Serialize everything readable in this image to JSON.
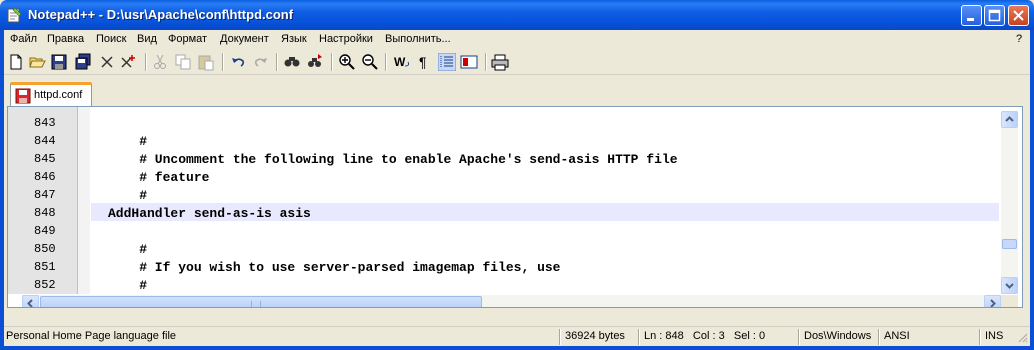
{
  "window": {
    "title": "Notepad++ - D:\\usr\\Apache\\conf\\httpd.conf",
    "icon": "notepad-plus-icon"
  },
  "menu": {
    "items": [
      "Файл",
      "Правка",
      "Поиск",
      "Вид",
      "Формат",
      "Документ",
      "Язык",
      "Настройки",
      "Выполнить..."
    ],
    "help": "?"
  },
  "toolbar": {
    "icons": [
      "new-file-icon",
      "open-file-icon",
      "save-icon",
      "save-all-icon",
      "close-icon",
      "close-all-icon",
      "cut-icon",
      "copy-icon",
      "paste-icon",
      "undo-icon",
      "redo-icon",
      "find-icon",
      "replace-icon",
      "zoom-in-icon",
      "zoom-out-icon",
      "word-wrap-icon",
      "show-all-chars-icon",
      "indent-guide-icon",
      "user-define-icon",
      "print-icon"
    ]
  },
  "tabs": [
    {
      "label": "httpd.conf",
      "icon": "saved-file-red-icon"
    }
  ],
  "editor": {
    "lines": [
      {
        "num": "843",
        "text": ""
      },
      {
        "num": "844",
        "text": "    #"
      },
      {
        "num": "845",
        "text": "    # Uncomment the following line to enable Apache's send-asis HTTP file"
      },
      {
        "num": "846",
        "text": "    # feature"
      },
      {
        "num": "847",
        "text": "    #"
      },
      {
        "num": "848",
        "text": "AddHandler send-as-is asis"
      },
      {
        "num": "849",
        "text": ""
      },
      {
        "num": "850",
        "text": "    #"
      },
      {
        "num": "851",
        "text": "    # If you wish to use server-parsed imagemap files, use"
      },
      {
        "num": "852",
        "text": "    #"
      }
    ],
    "current_line": "848",
    "current_line_color": "#e8e8ff"
  },
  "status": {
    "file_type": "Personal Home Page language file",
    "size": "36924 bytes",
    "position": "Ln : 848   Col : 3   Sel : 0",
    "eol": "Dos\\Windows",
    "encoding": "ANSI",
    "mode": "INS"
  }
}
